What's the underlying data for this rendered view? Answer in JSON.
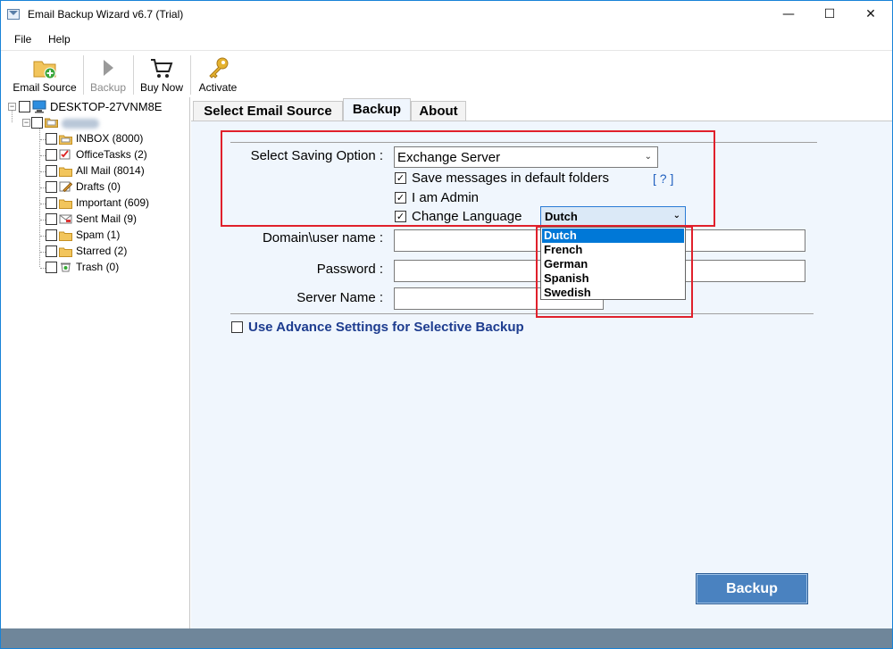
{
  "window": {
    "title": "Email Backup Wizard v6.7 (Trial)",
    "minimize": "—",
    "maximize": "☐",
    "close": "✕"
  },
  "menu": [
    "File",
    "Help"
  ],
  "toolbar": {
    "email_source": "Email Source",
    "backup": "Backup",
    "buy_now": "Buy Now",
    "activate": "Activate"
  },
  "tree": {
    "root": "DESKTOP-27VNM8E",
    "account": "",
    "folders": [
      {
        "label": "INBOX (8000)",
        "icon": "inbox-folder-icon"
      },
      {
        "label": "OfficeTasks (2)",
        "icon": "tasks-icon"
      },
      {
        "label": "All Mail (8014)",
        "icon": "folder-icon"
      },
      {
        "label": "Drafts (0)",
        "icon": "drafts-icon"
      },
      {
        "label": "Important (609)",
        "icon": "folder-icon"
      },
      {
        "label": "Sent Mail (9)",
        "icon": "sent-mail-icon"
      },
      {
        "label": "Spam (1)",
        "icon": "folder-icon"
      },
      {
        "label": "Starred (2)",
        "icon": "folder-icon"
      },
      {
        "label": "Trash (0)",
        "icon": "trash-icon"
      }
    ]
  },
  "tabs": [
    "Select Email Source",
    "Backup",
    "About"
  ],
  "form": {
    "saving_option_label": "Select Saving Option :",
    "saving_option_value": "Exchange Server",
    "save_default_folders": "Save messages in default folders",
    "help_link": "[ ? ]",
    "i_am_admin": "I am Admin",
    "change_language": "Change Language",
    "language_selected": "Dutch",
    "language_options": [
      "Dutch",
      "French",
      "German",
      "Spanish",
      "Swedish"
    ],
    "domain_user_label": "Domain\\user name :",
    "password_label": "Password :",
    "server_name_label": "Server Name :",
    "advance_settings": "Use Advance Settings for Selective Backup",
    "backup_button": "Backup"
  },
  "colors": {
    "accent": "#0078d7",
    "highlight_box": "#e0202b",
    "content_bg": "#f0f6fd",
    "button": "#4a82c0"
  }
}
